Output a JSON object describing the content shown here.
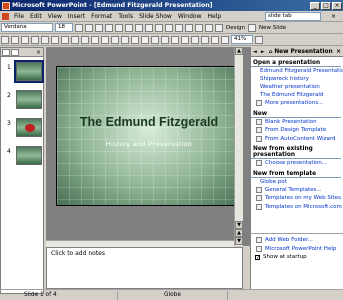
{
  "window": {
    "title": "Microsoft PowerPoint - [Edmund Fitzgerald Presentation]"
  },
  "menu": {
    "items": [
      "File",
      "Edit",
      "View",
      "Insert",
      "Format",
      "Tools",
      "Slide Show",
      "Window",
      "Help"
    ],
    "help_box": "slide tab",
    "close": "×"
  },
  "formatting": {
    "font": "Verdana",
    "size": "18",
    "design_label": "Design",
    "new_slide_label": "New Slide"
  },
  "standard": {
    "zoom": "41%"
  },
  "thumbnails": {
    "numbers": [
      "1",
      "2",
      "3",
      "4"
    ]
  },
  "slide": {
    "title": "The Edmund Fitzgerald",
    "subtitle": "History and Preservation"
  },
  "notes": {
    "placeholder": "Click to add notes"
  },
  "taskpane": {
    "title": "New Presentation",
    "open_header": "Open a presentation",
    "open_items": [
      "Edmund Fitzgerald Presentation",
      "Shipwreck history",
      "Weather presentation",
      "The Edmund Fitzgerald"
    ],
    "more": "More presentations...",
    "new_header": "New",
    "new_items": [
      "Blank Presentation",
      "From Design Template",
      "From AutoContent Wizard"
    ],
    "existing_header": "New from existing presentation",
    "existing_items": [
      "Choose presentation..."
    ],
    "template_header": "New from template",
    "template_items": [
      "Globe.pot",
      "General Templates...",
      "Templates on my Web Sites...",
      "Templates on Microsoft.com"
    ],
    "footer_items": [
      "Add Web Folder...",
      "Microsoft PowerPoint Help"
    ],
    "show_startup": "Show at startup"
  },
  "status": {
    "slide": "Slide 1 of 4",
    "design": "Globe"
  }
}
